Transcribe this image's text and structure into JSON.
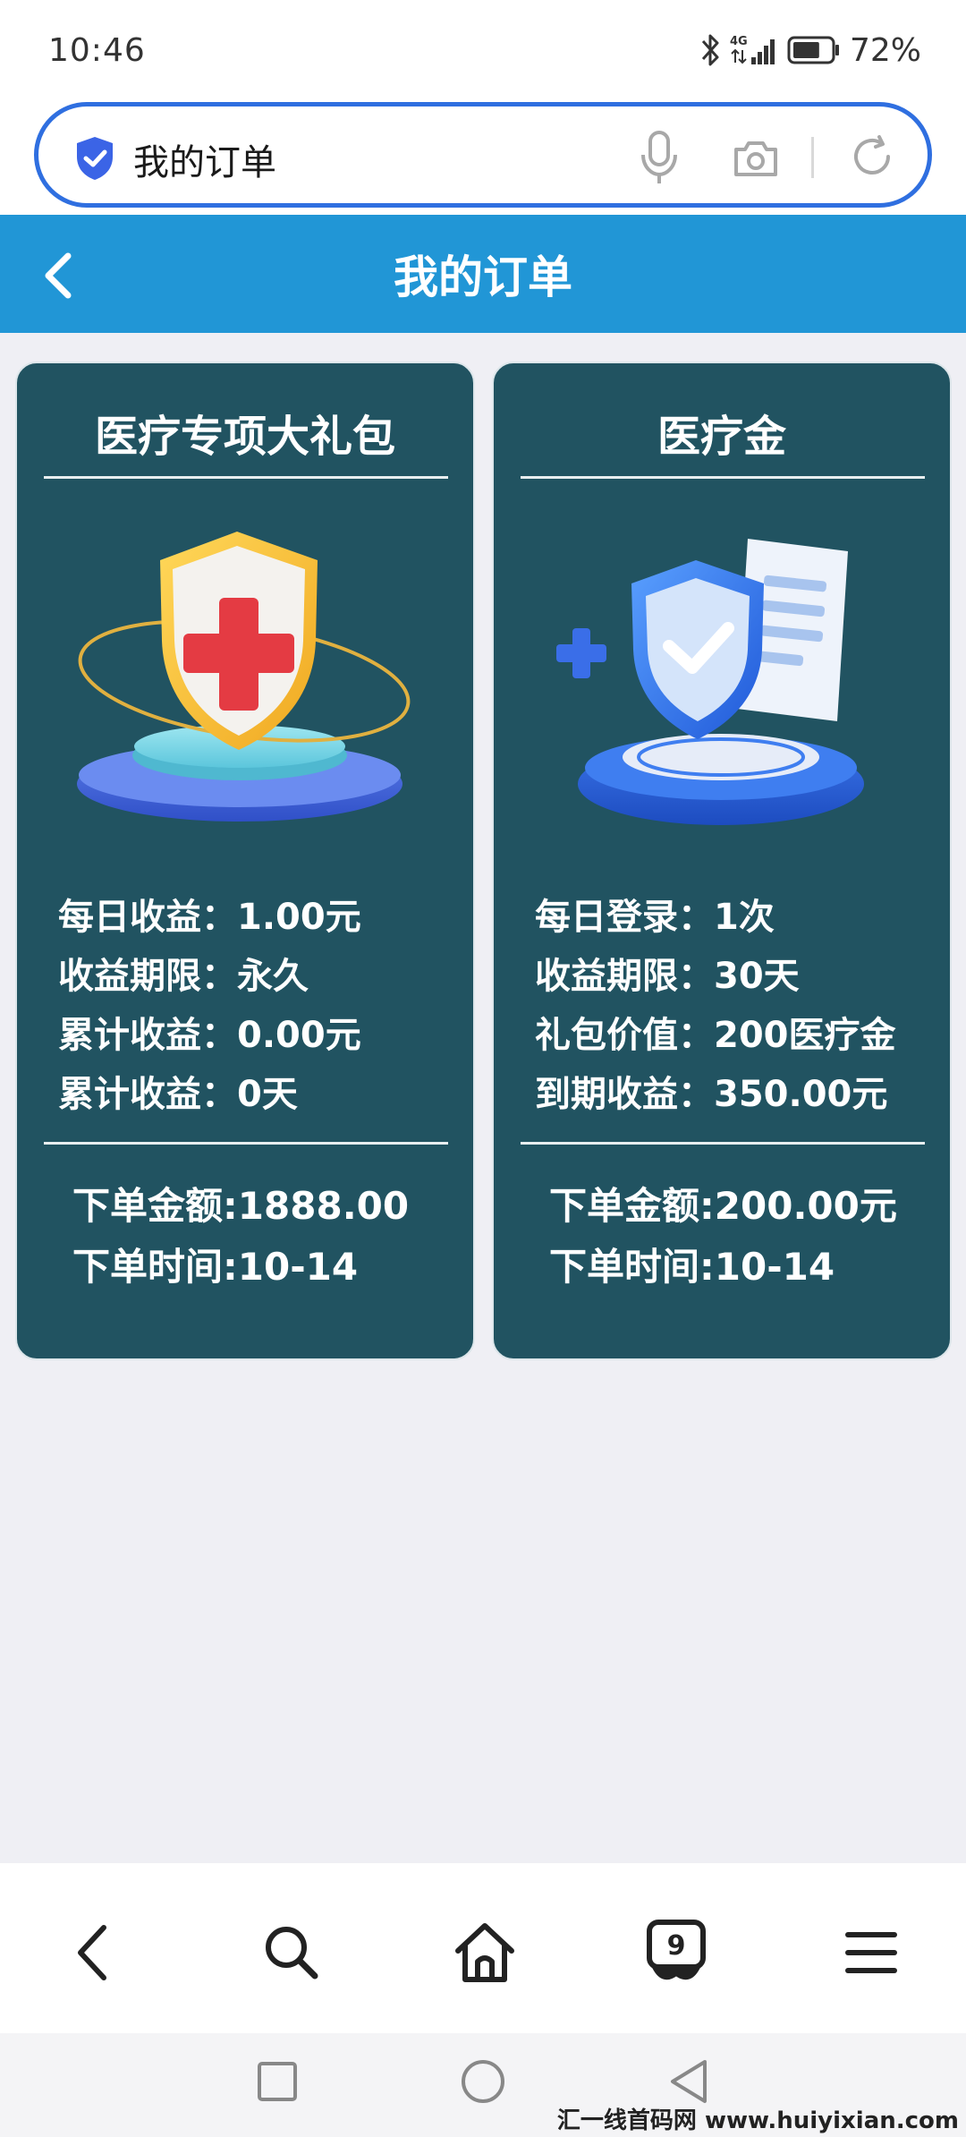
{
  "status_bar": {
    "time": "10:46",
    "network": "4G",
    "battery": "72%",
    "battery_level_pct": 72,
    "icons": [
      "bluetooth-icon",
      "signal-icon",
      "battery-icon"
    ]
  },
  "browser": {
    "search_text": "我的订单",
    "icons": [
      "shield-check-icon",
      "microphone-icon",
      "camera-icon",
      "refresh-icon"
    ]
  },
  "header": {
    "title": "我的订单"
  },
  "cards": [
    {
      "title": "医疗专项大礼包",
      "image": "shield-red-cross-icon",
      "info": [
        {
          "label": "每日收益：",
          "value": "1.00元"
        },
        {
          "label": "收益期限：",
          "value": "永久"
        },
        {
          "label": "累计收益：",
          "value": "0.00元"
        },
        {
          "label": "累计收益：",
          "value": "0天"
        }
      ],
      "order": [
        {
          "label": "下单金额:",
          "value": "1888.00"
        },
        {
          "label": "下单时间:",
          "value": "10-14"
        }
      ]
    },
    {
      "title": "医疗金",
      "image": "shield-check-document-icon",
      "info": [
        {
          "label": "每日登录：",
          "value": "1次"
        },
        {
          "label": "收益期限：",
          "value": "30天"
        },
        {
          "label": "礼包价值：",
          "value": "200医疗金"
        },
        {
          "label": "到期收益：",
          "value": "350.00元"
        }
      ],
      "order": [
        {
          "label": "下单金额:",
          "value": "200.00元"
        },
        {
          "label": "下单时间:",
          "value": "10-14"
        }
      ]
    }
  ],
  "browser_nav": {
    "tab_count": "9",
    "icons": [
      "back-arrow-icon",
      "search-icon",
      "home-icon",
      "tabs-icon",
      "menu-icon"
    ]
  },
  "system_nav": {
    "icons": [
      "recent-apps-icon",
      "home-circle-icon",
      "back-triangle-icon"
    ]
  },
  "watermark": "汇一线首码网 www.huiyixian.com",
  "colors": {
    "header": "#2196d6",
    "card": "#215361",
    "search_border": "#2f6fe0",
    "background": "#efeff4"
  }
}
